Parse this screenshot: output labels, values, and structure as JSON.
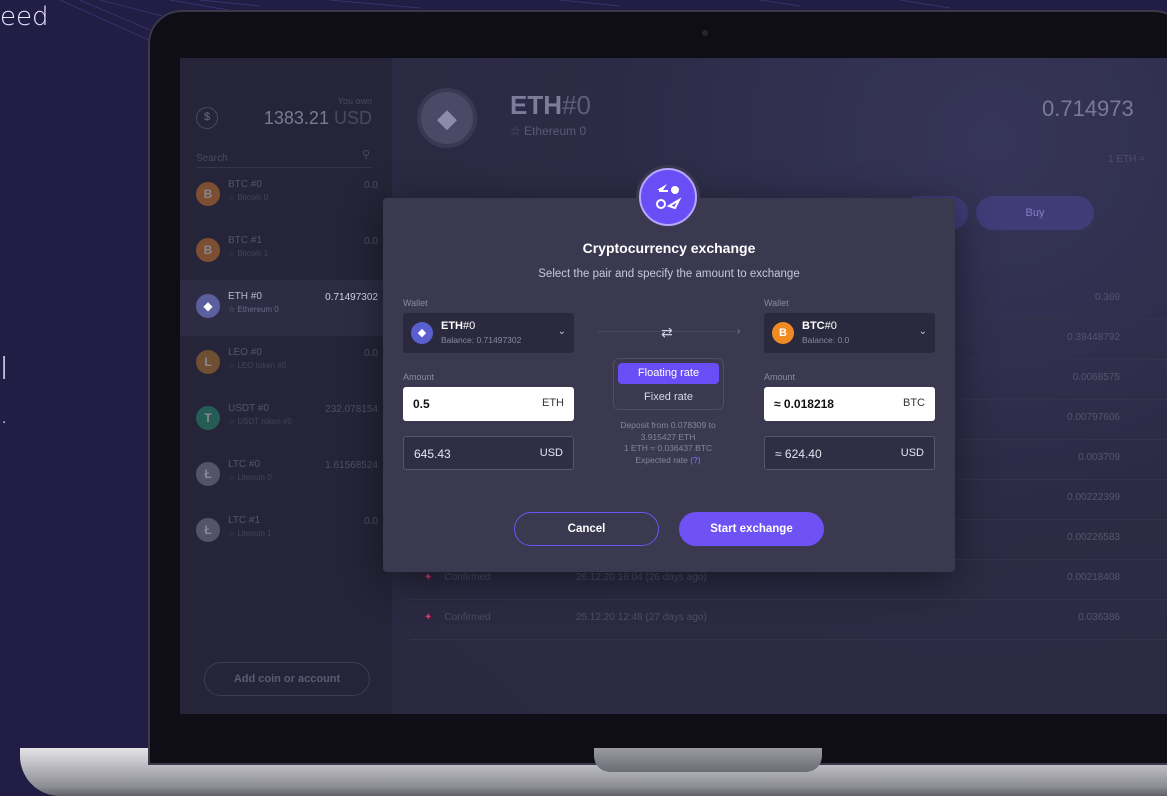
{
  "background": {
    "accent": "#6e52f6",
    "base": "#221d45"
  },
  "side_text": {
    "top": "eed",
    "line1": "l",
    "line2": "."
  },
  "sidebar": {
    "you_own_label": "You own",
    "total_value": "1383.21",
    "total_currency": "USD",
    "total_icon": "$",
    "search_placeholder": "Search",
    "coins": [
      {
        "name": "BTC #0",
        "sub": "☆ Bitcoin 0",
        "balance": "0.0",
        "icon": "bitcoin-icon",
        "symbol": "B",
        "color": "#e8822b",
        "active": false
      },
      {
        "name": "BTC #1",
        "sub": "☆ Bitcoin 1",
        "balance": "0.0",
        "icon": "bitcoin-icon",
        "symbol": "B",
        "color": "#e8822b",
        "active": false
      },
      {
        "name": "ETH #0",
        "sub": "☆ Ethereum 0",
        "balance": "0.71497302",
        "icon": "ethereum-icon",
        "symbol": "◆",
        "color": "#5a5f9e",
        "active": true
      },
      {
        "name": "LEO #0",
        "sub": "☆ LEO token #0",
        "balance": "0.0",
        "icon": "leo-icon",
        "symbol": "L",
        "color": "#c7842c",
        "active": false
      },
      {
        "name": "USDT #0",
        "sub": "☆ USDT token #0",
        "balance": "232.078154",
        "icon": "tether-icon",
        "symbol": "T",
        "color": "#26a17b",
        "active": false
      },
      {
        "name": "LTC #0",
        "sub": "☆ Litecoin 0",
        "balance": "1.61568524",
        "icon": "litecoin-icon",
        "symbol": "Ł",
        "color": "#8d8ea3",
        "active": false
      },
      {
        "name": "LTC #1",
        "sub": "☆ Litecoin 1",
        "balance": "0.0",
        "icon": "litecoin-icon",
        "symbol": "Ł",
        "color": "#8d8ea3",
        "active": false
      }
    ],
    "add_coin_label": "Add coin or account"
  },
  "main": {
    "coin_symbol": "ETH",
    "coin_hash": "#0",
    "coin_sub": "☆ Ethereum 0",
    "balance": "0.714973",
    "rate_hint": "1 ETH =",
    "buy_label": "Buy",
    "history": [
      {
        "status": "",
        "date": "",
        "amount": "0.369"
      },
      {
        "status": "",
        "date": "",
        "amount": "0.39448792"
      },
      {
        "status": "",
        "date": "",
        "amount": "0.0068575"
      },
      {
        "status": "",
        "date": "",
        "amount": "0.00797606"
      },
      {
        "status": "",
        "date": "",
        "amount": "0.003709"
      },
      {
        "status": "",
        "date": "",
        "amount": "0.00222399"
      },
      {
        "status": "",
        "date": "",
        "amount": "0.00226583"
      },
      {
        "status": "Confirmed",
        "date": "26.12.20 16:04 (26 days ago)",
        "amount": "0.00218408"
      },
      {
        "status": "Confirmed",
        "date": "25.12.20 12:48 (27 days ago)",
        "amount": "0.036386"
      }
    ]
  },
  "modal": {
    "title": "Cryptocurrency exchange",
    "subtitle": "Select the pair and specify the amount to exchange",
    "from": {
      "wallet_label": "Wallet",
      "name": "ETH",
      "hash": "#0",
      "balance": "Balance: 0.71497302",
      "icon": "ethereum-icon",
      "symbol": "◆",
      "color": "#5a5fd0",
      "amount_label": "Amount",
      "amount": "0.5",
      "amount_unit": "ETH",
      "usd": "645.43",
      "usd_unit": "USD"
    },
    "to": {
      "wallet_label": "Wallet",
      "name": "BTC",
      "hash": "#0",
      "balance": "Balance: 0.0",
      "icon": "bitcoin-icon",
      "symbol": "B",
      "color": "#f08a23",
      "amount_label": "Amount",
      "amount": "≈ 0.018218",
      "amount_unit": "BTC",
      "usd": "≈ 624.40",
      "usd_unit": "USD"
    },
    "rate_floating": "Floating rate",
    "rate_fixed": "Fixed rate",
    "deposit_line1": "Deposit from 0.078309 to",
    "deposit_line2": "3.915427 ETH",
    "deposit_line3": "1 ETH ≈ 0.036437 BTC",
    "deposit_line4": "Expected rate",
    "deposit_help": "(?)",
    "cancel_label": "Cancel",
    "start_label": "Start exchange"
  }
}
